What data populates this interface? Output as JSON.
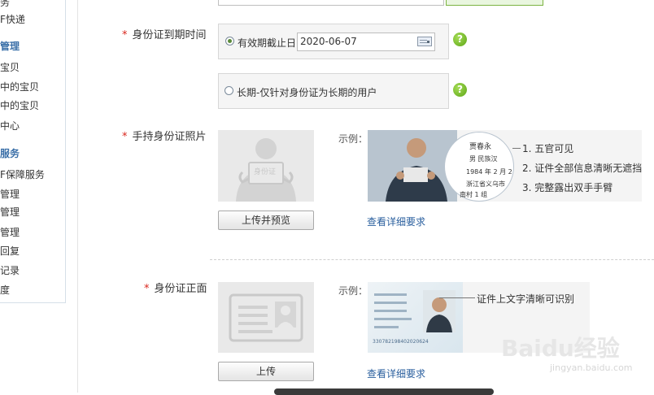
{
  "sidebar": {
    "items": [
      {
        "label": "务",
        "type": "item"
      },
      {
        "label": "F快递",
        "type": "item"
      },
      {
        "label": "管理",
        "type": "head"
      },
      {
        "label": "宝贝",
        "type": "item"
      },
      {
        "label": "中的宝贝",
        "type": "item"
      },
      {
        "label": "中的宝贝",
        "type": "item"
      },
      {
        "label": "中心",
        "type": "item"
      },
      {
        "label": "服务",
        "type": "head"
      },
      {
        "label": "F保障服务",
        "type": "item"
      },
      {
        "label": "管理",
        "type": "item"
      },
      {
        "label": "管理",
        "type": "item"
      },
      {
        "label": "管理",
        "type": "item"
      },
      {
        "label": "回复",
        "type": "item"
      },
      {
        "label": "记录",
        "type": "item"
      },
      {
        "label": "度",
        "type": "item"
      }
    ]
  },
  "form": {
    "required_mark": "*",
    "expiry": {
      "label": "身份证到期时间",
      "option_until_label": "有效期截止日",
      "date_value": "2020-06-07",
      "option_longterm_label": "长期-仅针对身份证为长期的用户",
      "help_icon": "question-icon"
    },
    "handheld": {
      "label": "手持身份证照片",
      "placeholder_text": "身份证",
      "upload_button": "上传并预览",
      "example_label": "示例：",
      "details_link": "查看详细要求",
      "tips": [
        "1. 五官可见",
        "2. 证件全部信息清晰无遮挡",
        "3. 完整露出双手手臂"
      ],
      "card_lines": [
        "贾春永",
        "男  民族汉",
        "1984 年 2 月 2",
        "浙江省义乌市",
        "南村 1 组"
      ]
    },
    "front": {
      "label": "身份证正面",
      "upload_button": "上传",
      "example_label": "示例：",
      "details_link": "查看详细要求",
      "note": "证件上文字清晰可识别",
      "card_number": "330782198402020624"
    }
  },
  "watermark": {
    "logo": "Baidu经验",
    "url": "jingyan.baidu.com"
  },
  "colors": {
    "required": "#d9261c",
    "link": "#2a5f9e",
    "help_green": "#5ea617",
    "sidebar_head": "#3a6fa8"
  }
}
